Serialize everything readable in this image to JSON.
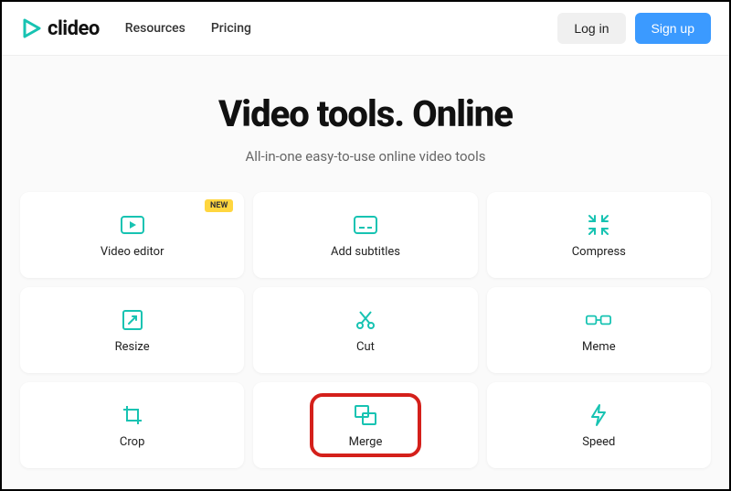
{
  "header": {
    "brand": "clideo",
    "nav": [
      "Resources",
      "Pricing"
    ],
    "login": "Log in",
    "signup": "Sign up"
  },
  "hero": {
    "title": "Video tools. Online",
    "subtitle": "All-in-one easy-to-use online video tools"
  },
  "badge_new": "NEW",
  "tools": [
    {
      "label": "Video editor",
      "icon": "play-rect",
      "badge": true
    },
    {
      "label": "Add subtitles",
      "icon": "subtitle"
    },
    {
      "label": "Compress",
      "icon": "compress"
    },
    {
      "label": "Resize",
      "icon": "resize"
    },
    {
      "label": "Cut",
      "icon": "cut"
    },
    {
      "label": "Meme",
      "icon": "meme"
    },
    {
      "label": "Crop",
      "icon": "crop"
    },
    {
      "label": "Merge",
      "icon": "merge",
      "highlighted": true
    },
    {
      "label": "Speed",
      "icon": "speed"
    }
  ],
  "colors": {
    "accent": "#17c3b2",
    "primary_btn": "#3b9aff",
    "highlight": "#d4201b"
  }
}
